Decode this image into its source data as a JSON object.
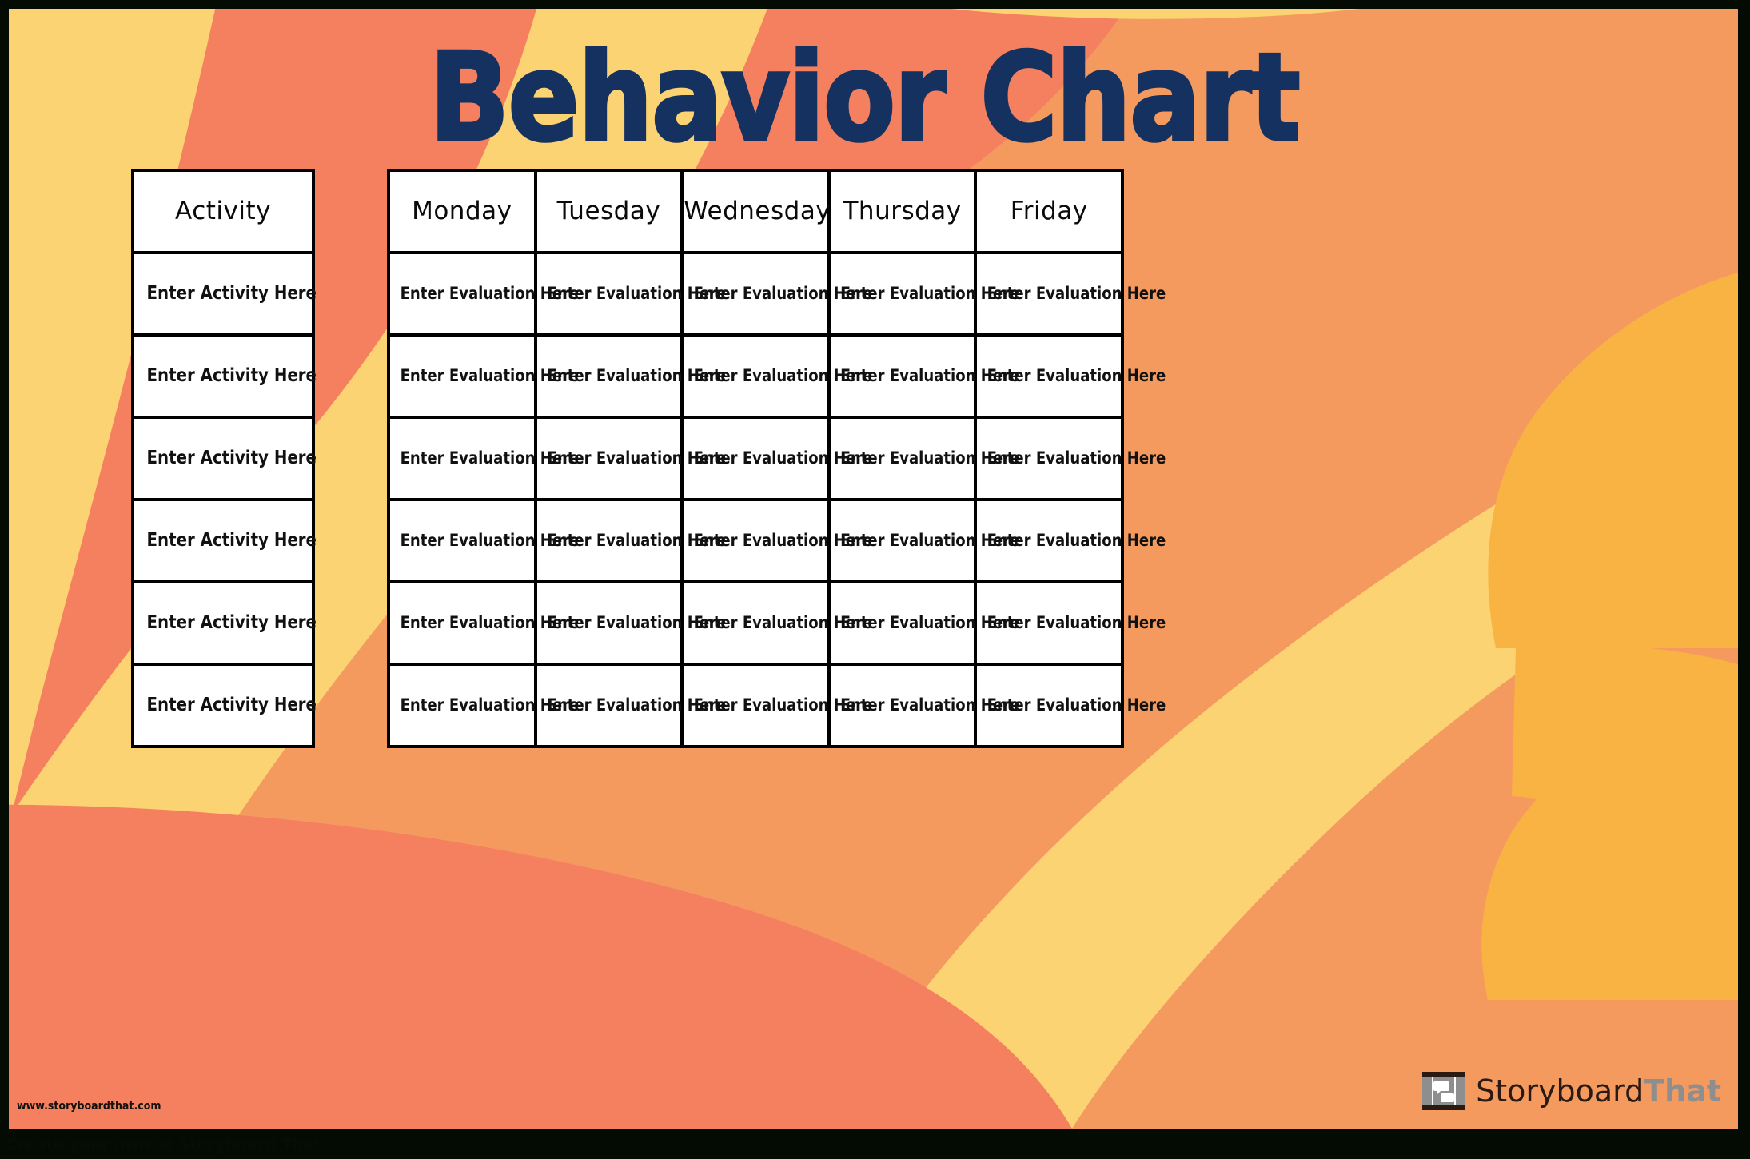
{
  "poster": {
    "title": "Behavior Chart",
    "title_color": "#143160",
    "background_colors": {
      "base_orange": "#f59a5f",
      "coral": "#f4805f",
      "yellow": "#fbd372",
      "amber": "#f9b342",
      "frame": "#030b03"
    }
  },
  "activity_table": {
    "header": "Activity",
    "rows": [
      "Enter Activity Here",
      "Enter Activity Here",
      "Enter Activity Here",
      "Enter Activity Here",
      "Enter Activity Here",
      "Enter Activity Here"
    ]
  },
  "days_table": {
    "headers": [
      "Monday",
      "Tuesday",
      "Wednesday",
      "Thursday",
      "Friday"
    ],
    "cell_placeholder": "Enter Evaluation Here",
    "rows": [
      [
        "Enter Evaluation Here",
        "Enter Evaluation Here",
        "Enter Evaluation Here",
        "Enter Evaluation Here",
        "Enter Evaluation Here"
      ],
      [
        "Enter Evaluation Here",
        "Enter Evaluation Here",
        "Enter Evaluation Here",
        "Enter Evaluation Here",
        "Enter Evaluation Here"
      ],
      [
        "Enter Evaluation Here",
        "Enter Evaluation Here",
        "Enter Evaluation Here",
        "Enter Evaluation Here",
        "Enter Evaluation Here"
      ],
      [
        "Enter Evaluation Here",
        "Enter Evaluation Here",
        "Enter Evaluation Here",
        "Enter Evaluation Here",
        "Enter Evaluation Here"
      ],
      [
        "Enter Evaluation Here",
        "Enter Evaluation Here",
        "Enter Evaluation Here",
        "Enter Evaluation Here",
        "Enter Evaluation Here"
      ],
      [
        "Enter Evaluation Here",
        "Enter Evaluation Here",
        "Enter Evaluation Here",
        "Enter Evaluation Here",
        "Enter Evaluation Here"
      ]
    ]
  },
  "footer": {
    "url": "www.storyboardthat.com",
    "caption": "Create your own at Storyboard That"
  },
  "logo": {
    "word_primary": "Storyboard",
    "word_secondary": "That",
    "icon": "filmstrip-speech-bubble-icon",
    "color_primary": "#2a1a12",
    "color_secondary": "#8e8e8e"
  }
}
